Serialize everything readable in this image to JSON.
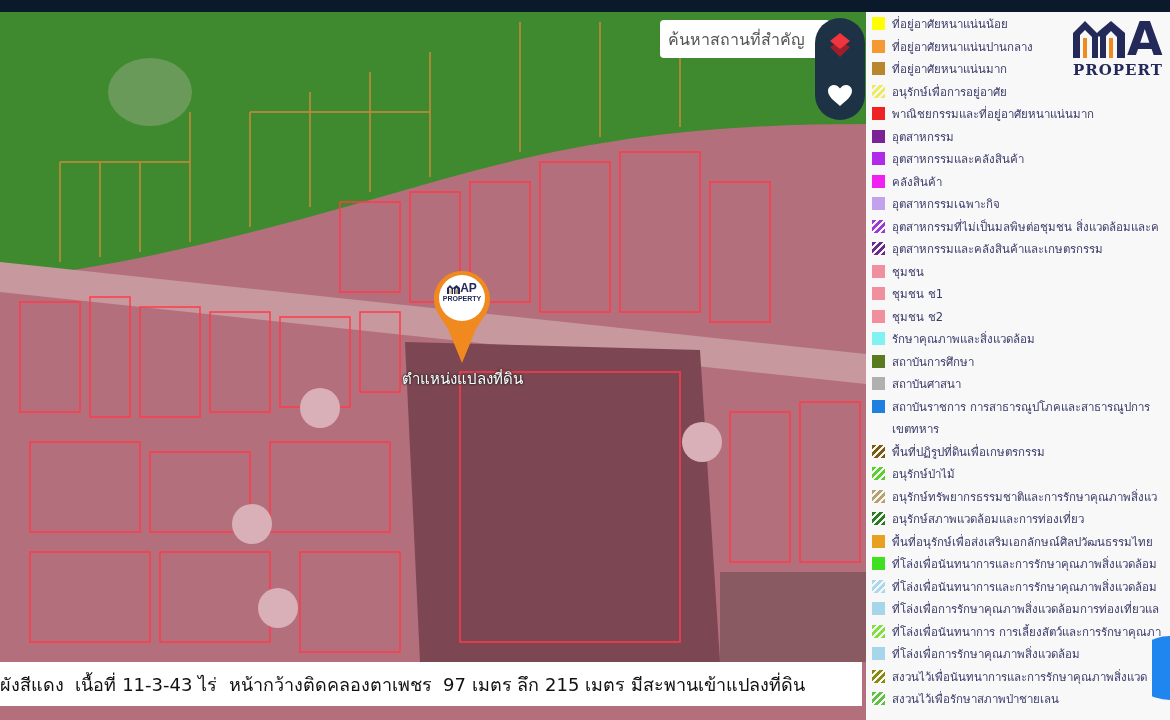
{
  "map": {
    "search": {
      "placeholder": "ค้นหาสถานที่สำคัญ"
    },
    "marker": {
      "logo_text": "AP",
      "logo_subtitle": "PROPERTY",
      "label": "ตำแหน่งแปลงที่ดิน"
    },
    "caption": "ผังสีแดง  เนื้อที่ 11-3-43 ไร่  หน้ากว้างติดคลองตาเพชร  97 เมตร ลึก 215 เมตร มีสะพานเข้าแปลงที่ดิน"
  },
  "legend": {
    "logo": {
      "mark_text": "A",
      "subtitle": "PROPERT"
    },
    "items": [
      {
        "label": "ที่อยู่อาศัยหนาแน่นน้อย",
        "color": "#ffff00",
        "kind": "solid"
      },
      {
        "label": "ที่อยู่อาศัยหนาแน่นปานกลาง",
        "color": "#f59a32",
        "kind": "solid"
      },
      {
        "label": "ที่อยู่อาศัยหนาแน่นมาก",
        "color": "#b8862b",
        "kind": "solid"
      },
      {
        "label": "อนุรักษ์เพื่อการอยู่อาศัย",
        "color": "#ecec5a",
        "kind": "striped"
      },
      {
        "label": "พาณิชยกรรมและที่อยู่อาศัยหนาแน่นมาก",
        "color": "#ee2222",
        "kind": "solid"
      },
      {
        "label": "อุตสาหกรรม",
        "color": "#7a2396",
        "kind": "solid"
      },
      {
        "label": "อุตสาหกรรมและคลังสินค้า",
        "color": "#b02ae8",
        "kind": "solid"
      },
      {
        "label": "คลังสินค้า",
        "color": "#f020f0",
        "kind": "solid"
      },
      {
        "label": "อุตสาหกรรมเฉพาะกิจ",
        "color": "#c2a2ec",
        "kind": "solid"
      },
      {
        "label": "อุตสาหกรรมที่ไม่เป็นมลพิษต่อชุมชน สิ่งแวดล้อมและค",
        "color": "#9b3ad8",
        "kind": "striped"
      },
      {
        "label": "อุตสาหกรรมและคลังสินค้าและเกษตรกรรม",
        "color": "#6a2a8a",
        "kind": "striped"
      },
      {
        "label": "ชุมชน",
        "color": "#f0909e",
        "kind": "solid"
      },
      {
        "label": "ชุมชน ช1",
        "color": "#f0909e",
        "kind": "solid"
      },
      {
        "label": "ชุมชน ช2",
        "color": "#f0909e",
        "kind": "solid"
      },
      {
        "label": "รักษาคุณภาพและสิ่งแวดล้อม",
        "color": "#80f2f2",
        "kind": "solid"
      },
      {
        "label": "สถาบันการศึกษา",
        "color": "#5a7a20",
        "kind": "solid"
      },
      {
        "label": "สถาบันศาสนา",
        "color": "#b0b0b0",
        "kind": "solid"
      },
      {
        "label": "สถาบันราชการ การสาธารณูปโภคและสาธารณูปการ\nเขตทหาร",
        "color": "#2080e0",
        "kind": "solid"
      },
      {
        "label": "พื้นที่ปฏิรูปที่ดินเพื่อเกษตรกรรม",
        "color": "#7a5a10",
        "kind": "striped"
      },
      {
        "label": "อนุรักษ์ป่าไม้",
        "color": "#5ad02a",
        "kind": "striped"
      },
      {
        "label": "อนุรักษ์ทรัพยากรธรรมชาติและการรักษาคุณภาพสิ่งแว",
        "color": "#b8a070",
        "kind": "striped"
      },
      {
        "label": "อนุรักษ์สภาพแวดล้อมและการท่องเที่ยว",
        "color": "#2a7a20",
        "kind": "striped"
      },
      {
        "label": "พื้นที่อนุรักษ์เพื่อส่งเสริมเอกลักษณ์ศิลปวัฒนธรรมไทย",
        "color": "#e8a020",
        "kind": "solid"
      },
      {
        "label": "ที่โล่งเพื่อนันทนาการและการรักษาคุณภาพสิ่งแวดล้อม",
        "color": "#40e020",
        "kind": "solid"
      },
      {
        "label": "ที่โล่งเพื่อนันทนาการและการรักษาคุณภาพสิ่งแวดล้อม",
        "color": "#a8d8f0",
        "kind": "striped"
      },
      {
        "label": "ที่โล่งเพื่อการรักษาคุณภาพสิ่งแวดล้อมการท่องเที่ยวแล",
        "color": "#a6d6ea",
        "kind": "solid"
      },
      {
        "label": "ที่โล่งเพื่อนันทนาการ การเลี้ยงสัตว์และการรักษาคุณภา",
        "color": "#80e040",
        "kind": "striped"
      },
      {
        "label": "ที่โล่งเพื่อการรักษาคุณภาพสิ่งแวดล้อม",
        "color": "#a6d6ea",
        "kind": "solid"
      },
      {
        "label": "สงวนไว้เพื่อนันทนาการและการรักษาคุณภาพสิ่งแวด",
        "color": "#8a8a10",
        "kind": "striped"
      },
      {
        "label": "สงวนไว้เพื่อรักษาสภาพป่าชายเลน",
        "color": "#60c040",
        "kind": "striped"
      }
    ]
  }
}
